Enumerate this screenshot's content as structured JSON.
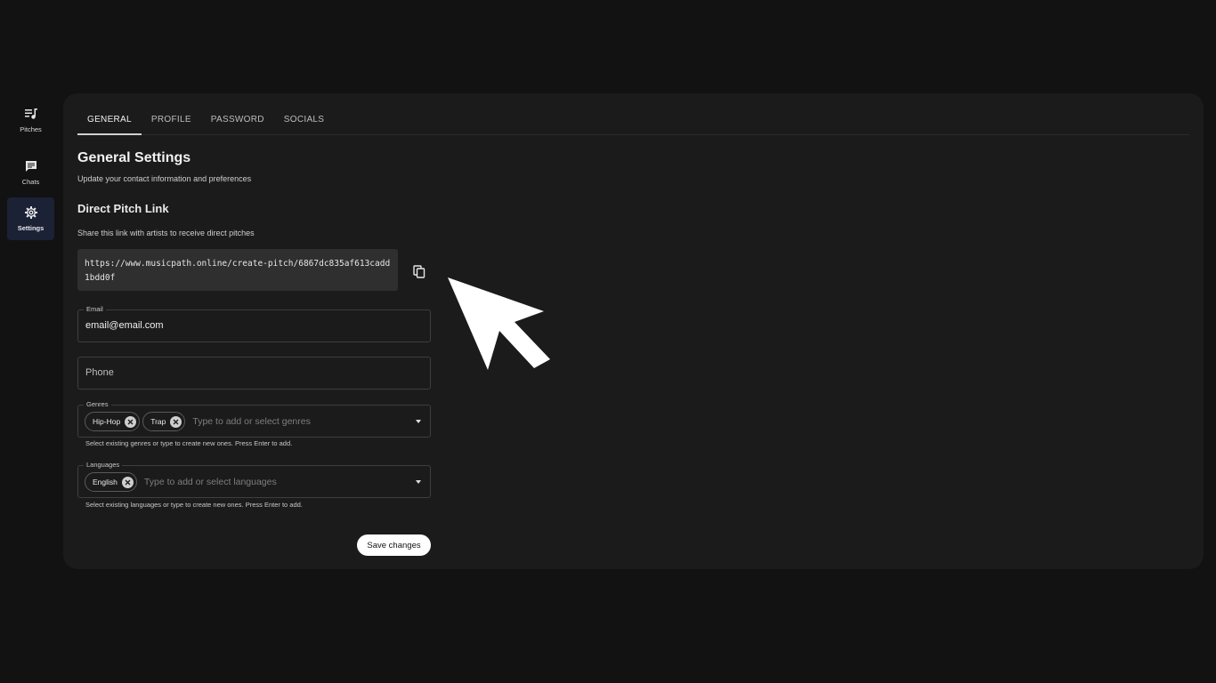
{
  "sidebar": {
    "items": [
      {
        "label": "Pitches",
        "icon": "playlist-music-icon"
      },
      {
        "label": "Chats",
        "icon": "chat-icon"
      },
      {
        "label": "Settings",
        "icon": "gear-icon",
        "active": true
      }
    ]
  },
  "tabs": [
    {
      "label": "GENERAL",
      "active": true
    },
    {
      "label": "PROFILE"
    },
    {
      "label": "PASSWORD"
    },
    {
      "label": "SOCIALS"
    }
  ],
  "general": {
    "title": "General Settings",
    "subtitle": "Update your contact information and preferences"
  },
  "pitch_link": {
    "title": "Direct Pitch Link",
    "description": "Share this link with artists to receive direct pitches",
    "url": "https://www.musicpath.online/create-pitch/6867dc835af613cadd1bdd0f",
    "copy_icon": "copy-icon"
  },
  "form": {
    "email": {
      "label": "Email",
      "value": "email@email.com"
    },
    "phone": {
      "placeholder": "Phone"
    },
    "genres": {
      "label": "Genres",
      "chips": [
        "Hip-Hop",
        "Trap"
      ],
      "placeholder": "Type to add or select genres",
      "helper": "Select existing genres or type to create new ones. Press Enter to add."
    },
    "languages": {
      "label": "Languages",
      "chips": [
        "English"
      ],
      "placeholder": "Type to add or select languages",
      "helper": "Select existing languages or type to create new ones. Press Enter to add."
    },
    "save_label": "Save changes"
  },
  "colors": {
    "background": "#121212",
    "card": "#1b1b1b",
    "active_nav": "#1b2236",
    "link_box": "#2f2f2f"
  }
}
